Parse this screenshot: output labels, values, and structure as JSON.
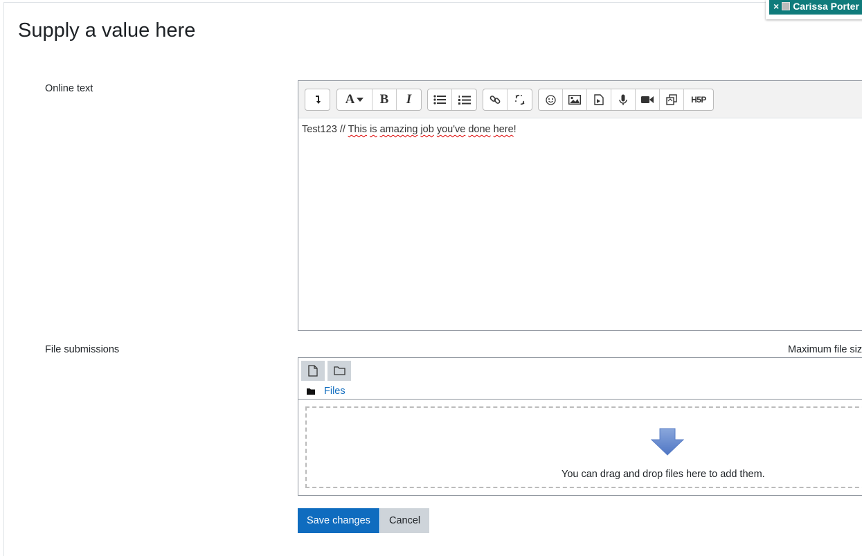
{
  "user_tag": {
    "close": "×",
    "name": "Carissa Porter"
  },
  "page_title": "Supply a value here",
  "online_text": {
    "label": "Online text",
    "content_prefix": "Test123 // ",
    "content_words": [
      "This",
      "is",
      "amazing",
      "job",
      "you've",
      "done",
      "here"
    ],
    "content_suffix": "!"
  },
  "toolbar_icons": [
    "collapse-icon",
    "font-style-icon",
    "bold-icon",
    "italic-icon",
    "unordered-list-icon",
    "ordered-list-icon",
    "link-icon",
    "unlink-icon",
    "emoji-icon",
    "image-icon",
    "media-icon",
    "record-audio-icon",
    "record-video-icon",
    "manage-files-icon",
    "h5p-icon"
  ],
  "toolbar_text": {
    "bold": "B",
    "italic": "I",
    "font": "A",
    "h5p": "H5P"
  },
  "file_submissions": {
    "label": "File submissions",
    "max_size_label": "Maximum file size",
    "path_link": "Files",
    "drop_text": "You can drag and drop files here to add them."
  },
  "buttons": {
    "save": "Save changes",
    "cancel": "Cancel"
  },
  "colors": {
    "primary": "#0f6cbf",
    "secondary": "#ced4da",
    "user_tag": "#0f7b7b"
  }
}
